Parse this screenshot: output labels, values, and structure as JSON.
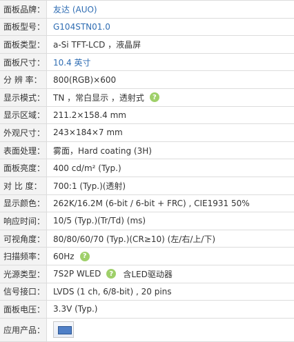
{
  "specs": [
    {
      "label": "面板品牌：",
      "value": "友达 (AUO)",
      "link": true
    },
    {
      "label": "面板型号：",
      "value": "G104STN01.0",
      "link": true
    },
    {
      "label": "面板类型：",
      "value": "a-Si TFT-LCD ，液晶屏"
    },
    {
      "label": "面板尺寸：",
      "value": "10.4 英寸",
      "link": true
    },
    {
      "label": "分 辨 率：",
      "value": "800(RGB)×600"
    },
    {
      "label": "显示模式：",
      "value": "TN ，常白显示 ，透射式",
      "help": true
    },
    {
      "label": "显示区域：",
      "value": "211.2×158.4 mm"
    },
    {
      "label": "外观尺寸：",
      "value": "243×184×7 mm"
    },
    {
      "label": "表面处理：",
      "value": "雾面，Hard coating (3H)"
    },
    {
      "label": "面板亮度：",
      "value": "400 cd/m² (Typ.)"
    },
    {
      "label": "对 比 度：",
      "value": "700:1 (Typ.)(透射)"
    },
    {
      "label": "显示颜色：",
      "value": "262K/16.2M   (6-bit / 6-bit + FRC) , CIE1931 50%"
    },
    {
      "label": "响应时间：",
      "value": "10/5 (Typ.)(Tr/Td) (ms)"
    },
    {
      "label": "可视角度：",
      "value": "80/80/60/70 (Typ.)(CR≥10) (左/右/上/下)"
    },
    {
      "label": "扫描频率：",
      "value": "60Hz",
      "help": true
    },
    {
      "label": "光源类型：",
      "value": "7S2P WLED",
      "help": true,
      "extra": "含LED驱动器"
    },
    {
      "label": "信号接口：",
      "value": "LVDS (1 ch, 6/8-bit) , 20 pins"
    },
    {
      "label": "面板电压：",
      "value": "3.3V (Typ.)"
    }
  ],
  "application": {
    "label": "应用产品：",
    "icon": "monitor-thumbnail-icon"
  },
  "help_glyph": "?",
  "colors": {
    "link": "#2f6db3",
    "label_bg": "#f3f3f3",
    "border": "#dcdcdc",
    "help": "#9fd06a"
  }
}
